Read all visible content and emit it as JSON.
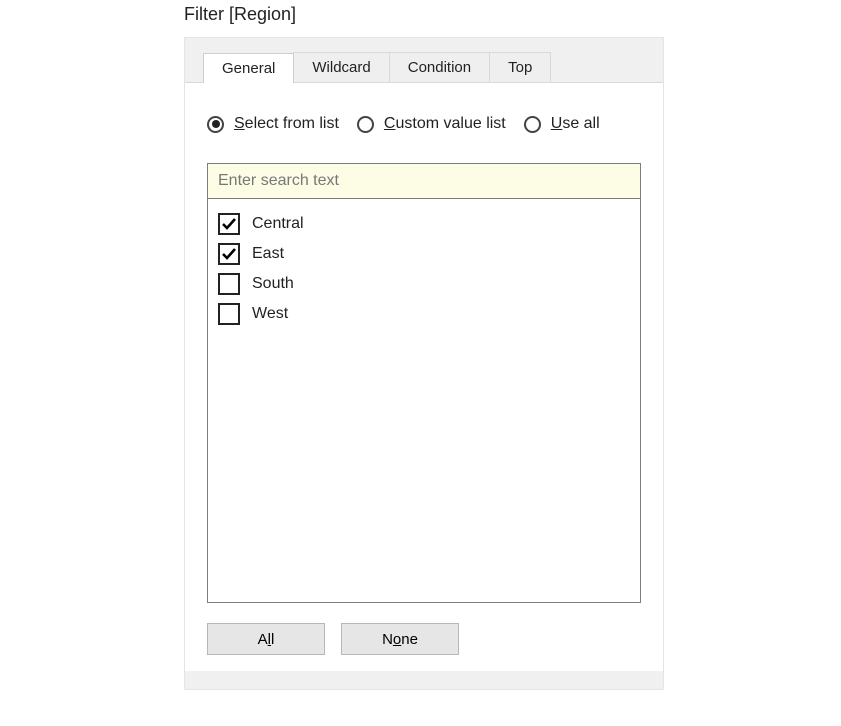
{
  "title": "Filter [Region]",
  "tabs": [
    {
      "label": "General",
      "active": true
    },
    {
      "label": "Wildcard",
      "active": false
    },
    {
      "label": "Condition",
      "active": false
    },
    {
      "label": "Top",
      "active": false
    }
  ],
  "radios": {
    "select_from_list": {
      "prefix": "S",
      "rest": "elect from list",
      "selected": true
    },
    "custom_value_list": {
      "prefix": "C",
      "rest": "ustom value list",
      "selected": false
    },
    "use_all": {
      "prefix": "U",
      "rest": "se all",
      "selected": false
    }
  },
  "search": {
    "placeholder": "Enter search text",
    "value": ""
  },
  "items": [
    {
      "label": "Central",
      "checked": true
    },
    {
      "label": "East",
      "checked": true
    },
    {
      "label": "South",
      "checked": false
    },
    {
      "label": "West",
      "checked": false
    }
  ],
  "buttons": {
    "all": {
      "prefix": "A",
      "ul": "l",
      "rest": "l"
    },
    "none": {
      "prefix": "N",
      "ul": "o",
      "rest": "ne"
    }
  }
}
